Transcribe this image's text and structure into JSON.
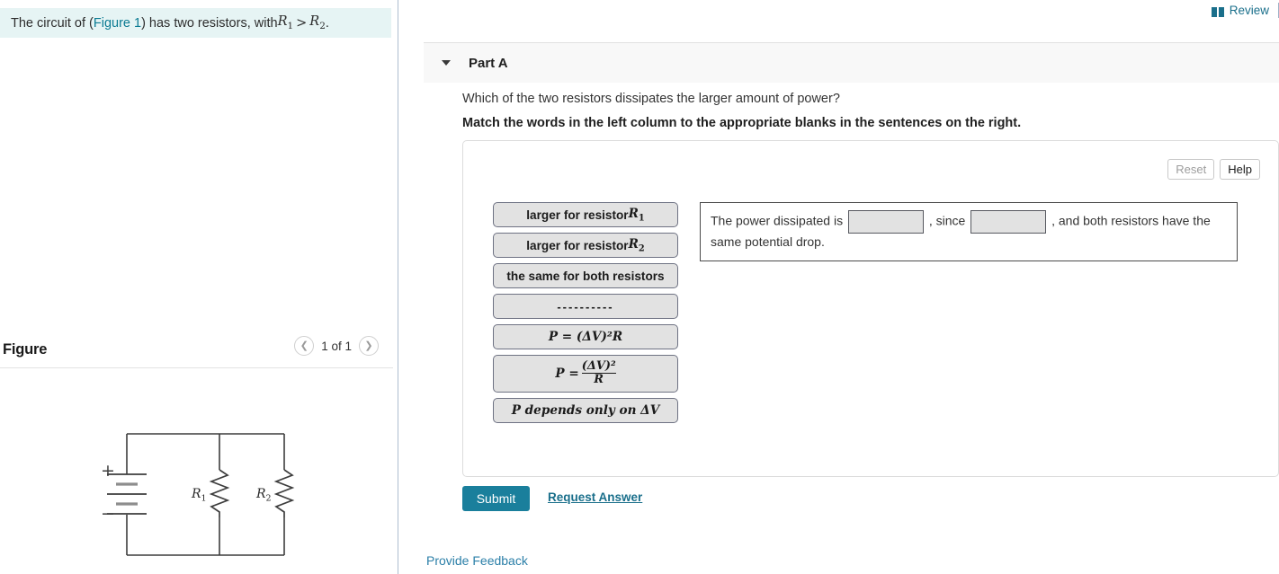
{
  "header": {
    "review_label": "Review",
    "review_icon": "book-icon"
  },
  "prompt": {
    "text_before": "The circuit of (",
    "figure_link": "Figure 1",
    "text_middle": ") has two resistors, with ",
    "var1": "R",
    "var1_sub": "1",
    "operator": ">",
    "var2": "R",
    "var2_sub": "2",
    "text_end": "."
  },
  "figure": {
    "title": "Figure",
    "pager_label": "1 of 1",
    "prev_icon": "chevron-left-icon",
    "next_icon": "chevron-right-icon",
    "circuit": {
      "plus_label": "+",
      "minus_label": "−",
      "resistor1": "R",
      "resistor1_sub": "1",
      "resistor2": "R",
      "resistor2_sub": "2"
    }
  },
  "part": {
    "title": "Part A",
    "caret_icon": "caret-down-icon",
    "question": "Which of the two resistors dissipates the larger amount of power?",
    "instruction": "Match the words in the left column to the appropriate blanks in the sentences on the right."
  },
  "tools": {
    "reset_label": "Reset",
    "help_label": "Help"
  },
  "word_bank": [
    {
      "kind": "text",
      "pre": "larger for resistor ",
      "var": "R",
      "sub": "1"
    },
    {
      "kind": "text",
      "pre": "larger for resistor ",
      "var": "R",
      "sub": "2"
    },
    {
      "kind": "plain",
      "label": "the same for both resistors"
    },
    {
      "kind": "dashes",
      "label": "----------"
    },
    {
      "kind": "eq1",
      "label": "P = (ΔV)²R"
    },
    {
      "kind": "frac",
      "lhs": "P =",
      "num": "(ΔV)²",
      "den": "R"
    },
    {
      "kind": "eq2",
      "label": "P depends only on ΔV"
    }
  ],
  "sentence": {
    "seg1": "The power dissipated is",
    "blank1_value": "",
    "seg2": ", since",
    "blank2_value": "",
    "seg3": ", and both resistors have the same potential drop."
  },
  "actions": {
    "submit_label": "Submit",
    "request_answer_label": "Request Answer",
    "provide_feedback_label": "Provide Feedback"
  },
  "colors": {
    "accent": "#1a7f9c",
    "link": "#1a6f8b",
    "banner_bg": "#e6f4f4",
    "tile_bg": "#e2e2e2"
  }
}
